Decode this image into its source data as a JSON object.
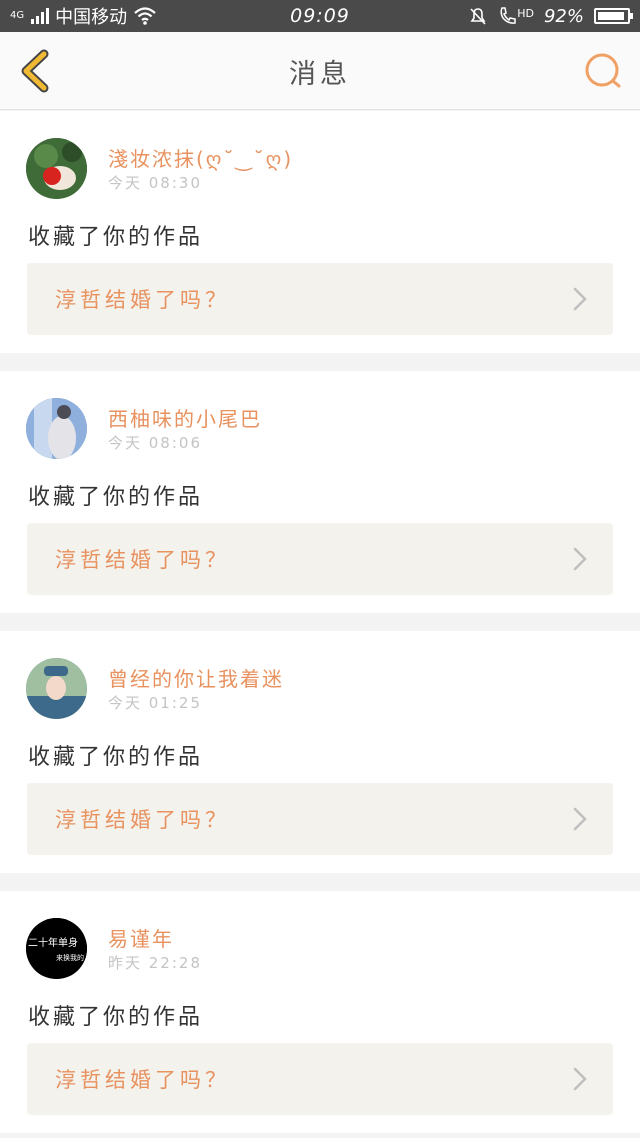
{
  "status_bar": {
    "network": "4G",
    "carrier": "中国移动",
    "time": "09:09",
    "hd_label": "HD",
    "battery_text": "92%",
    "battery_level": 0.92
  },
  "header": {
    "title": "消息"
  },
  "messages": [
    {
      "username": "淺妆浓抹(ღ˘‿˘ღ)",
      "time": "今天 08:30",
      "action": "收藏了你的作品",
      "work_title": "淳哲结婚了吗？",
      "avatar_color": "#3f6b39"
    },
    {
      "username": "西柚味的小尾巴",
      "time": "今天 08:06",
      "action": "收藏了你的作品",
      "work_title": "淳哲结婚了吗？",
      "avatar_color": "#7c9bc7"
    },
    {
      "username": "曾经的你让我着迷",
      "time": "今天 01:25",
      "action": "收藏了你的作品",
      "work_title": "淳哲结婚了吗？",
      "avatar_color": "#5d8fa3"
    },
    {
      "username": "易谨年",
      "time": "昨天 22:28",
      "action": "收藏了你的作品",
      "work_title": "淳哲结婚了吗？",
      "avatar_color": "#000000",
      "avatar_text_1": "二十年单身",
      "avatar_text_2": "来换我的"
    }
  ],
  "colors": {
    "accent": "#e8925f",
    "back_icon": "#f0b933",
    "card_bg": "#ffffff",
    "work_bg": "#f3f2ed"
  }
}
